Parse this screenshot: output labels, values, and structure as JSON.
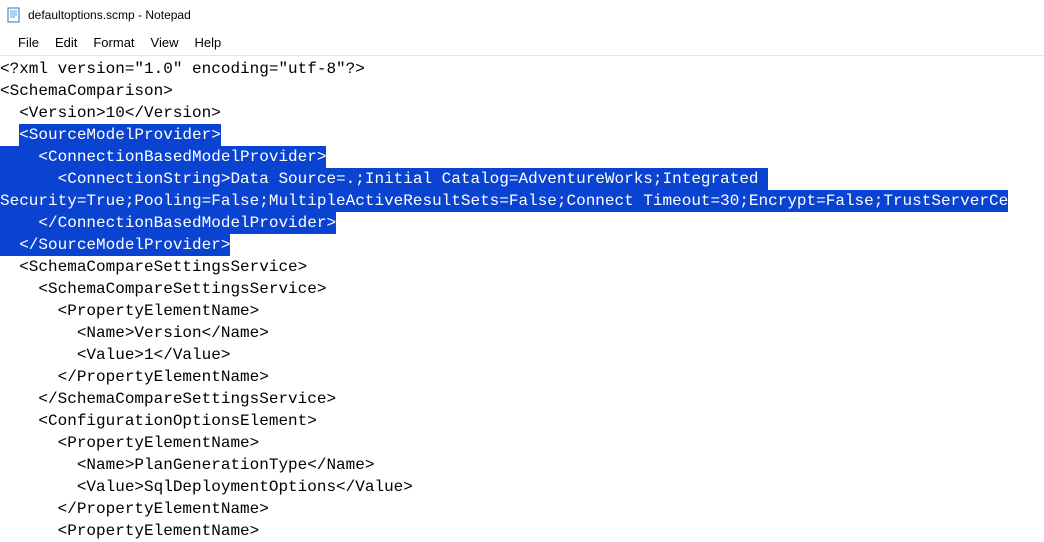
{
  "title": "defaultoptions.scmp - Notepad",
  "menu": {
    "file": "File",
    "edit": "Edit",
    "format": "Format",
    "view": "View",
    "help": "Help"
  },
  "editor": {
    "lines": [
      {
        "indent": 0,
        "text": "<?xml version=\"1.0\" encoding=\"utf-8\"?>"
      },
      {
        "indent": 0,
        "text": "<SchemaComparison>"
      },
      {
        "indent": 2,
        "text": "<Version>10</Version>"
      }
    ],
    "selected_block": {
      "leading_indent": 2,
      "line1": "<SourceModelProvider>",
      "line2_indent": 4,
      "line2": "<ConnectionBasedModelProvider>",
      "line3_indent": 6,
      "line3": "<ConnectionString>Data Source=.;Initial Catalog=AdventureWorks;Integrated ",
      "line4": "Security=True;Pooling=False;MultipleActiveResultSets=False;Connect Timeout=30;Encrypt=False;TrustServerCe",
      "line5_indent": 4,
      "line5": "</ConnectionBasedModelProvider>",
      "line6_indent": 2,
      "line6": "</SourceModelProvider>"
    },
    "lines_after": [
      {
        "indent": 2,
        "text": "<SchemaCompareSettingsService>"
      },
      {
        "indent": 4,
        "text": "<SchemaCompareSettingsService>"
      },
      {
        "indent": 6,
        "text": "<PropertyElementName>"
      },
      {
        "indent": 8,
        "text": "<Name>Version</Name>"
      },
      {
        "indent": 8,
        "text": "<Value>1</Value>"
      },
      {
        "indent": 6,
        "text": "</PropertyElementName>"
      },
      {
        "indent": 4,
        "text": "</SchemaCompareSettingsService>"
      },
      {
        "indent": 4,
        "text": "<ConfigurationOptionsElement>"
      },
      {
        "indent": 6,
        "text": "<PropertyElementName>"
      },
      {
        "indent": 8,
        "text": "<Name>PlanGenerationType</Name>"
      },
      {
        "indent": 8,
        "text": "<Value>SqlDeploymentOptions</Value>"
      },
      {
        "indent": 6,
        "text": "</PropertyElementName>"
      },
      {
        "indent": 6,
        "text": "<PropertyElementName>"
      }
    ]
  }
}
